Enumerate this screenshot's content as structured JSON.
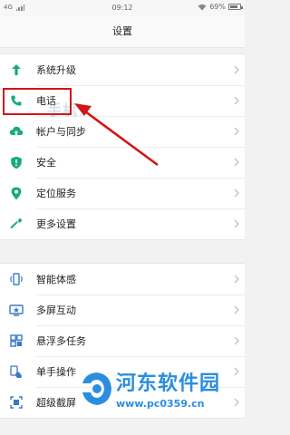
{
  "status_bar": {
    "network": "4G",
    "time": "09:12",
    "battery": "69%",
    "battery_level": 0.69
  },
  "title": "设置",
  "groups": [
    {
      "items": [
        {
          "label": "系统升级",
          "icon": "arrow-up-icon",
          "color": "#1aaa7a"
        },
        {
          "label": "电话",
          "icon": "phone-icon",
          "color": "#1aaa7a"
        },
        {
          "label": "帐户与同步",
          "icon": "cloud-sync-icon",
          "color": "#1aaa7a"
        },
        {
          "label": "安全",
          "icon": "shield-icon",
          "color": "#1aaa7a"
        },
        {
          "label": "定位服务",
          "icon": "location-pin-icon",
          "color": "#1aaa7a"
        },
        {
          "label": "更多设置",
          "icon": "wrench-icon",
          "color": "#1aaa7a"
        }
      ]
    },
    {
      "items": [
        {
          "label": "智能体感",
          "icon": "phone-motion-icon",
          "color": "#3a78c8"
        },
        {
          "label": "多屏互动",
          "icon": "multi-screen-icon",
          "color": "#3a78c8"
        },
        {
          "label": "悬浮多任务",
          "icon": "floating-tasks-icon",
          "color": "#3a78c8"
        },
        {
          "label": "单手操作",
          "icon": "one-hand-icon",
          "color": "#3a78c8"
        },
        {
          "label": "超级截屏",
          "icon": "screenshot-icon",
          "color": "#3a78c8"
        }
      ]
    }
  ],
  "annotation": {
    "highlight_color": "#d01616"
  },
  "watermark": {
    "site_name": "河东软件园",
    "site_url": "www.pc0359.cn",
    "color": "#2a8ee0"
  }
}
